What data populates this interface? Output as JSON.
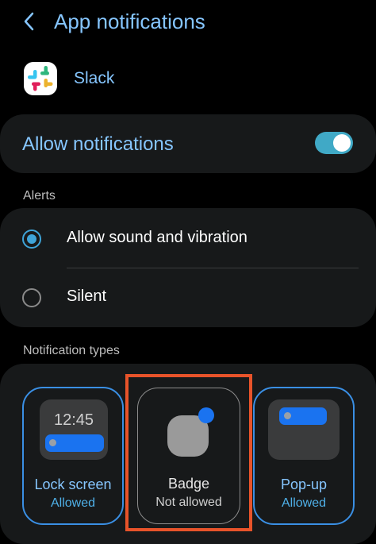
{
  "header": {
    "title": "App notifications",
    "back_icon": "chevron-left-icon"
  },
  "app": {
    "name": "Slack",
    "icon": "slack-logo"
  },
  "allow": {
    "label": "Allow notifications",
    "enabled": true
  },
  "alerts": {
    "header": "Alerts",
    "options": [
      {
        "label": "Allow sound and vibration",
        "selected": true
      },
      {
        "label": "Silent",
        "selected": false
      }
    ]
  },
  "types": {
    "header": "Notification types",
    "items": [
      {
        "label": "Lock screen",
        "status": "Allowed",
        "clock": "12:45"
      },
      {
        "label": "Badge",
        "status": "Not allowed"
      },
      {
        "label": "Pop-up",
        "status": "Allowed"
      }
    ]
  },
  "colors": {
    "accent": "#86c6ff",
    "toggle": "#40a9c6",
    "notification_blue": "#1a73f0",
    "highlight": "#e8532a"
  }
}
